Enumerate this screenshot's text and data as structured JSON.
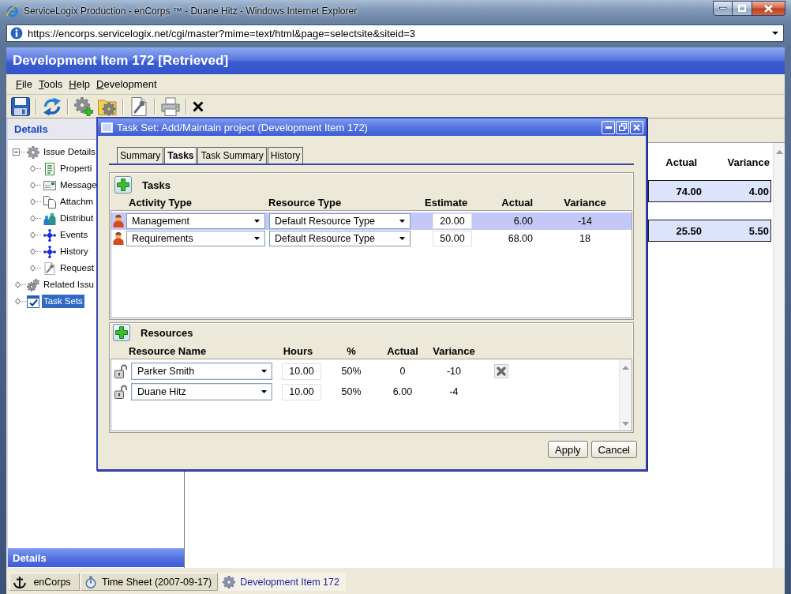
{
  "window": {
    "title": "ServiceLogix Production - enCorps ™ - Duane Hitz - Windows Internet Explorer"
  },
  "address_bar": {
    "url": "https://encorps.servicelogix.net/cgi/master?mime=text/html&page=selectsite&siteid=3"
  },
  "page_header": {
    "title": "Development Item 172 [Retrieved]"
  },
  "menu": [
    {
      "label": "File"
    },
    {
      "label": "Tools"
    },
    {
      "label": "Help"
    },
    {
      "label": "Development"
    }
  ],
  "sidebar": {
    "title": "Details",
    "tree": [
      {
        "label": "Issue Details",
        "expanded": true,
        "selected": false,
        "children": [
          {
            "label": "Properti",
            "selected": false
          },
          {
            "label": "Message",
            "selected": false
          },
          {
            "label": "Attachm",
            "selected": false
          },
          {
            "label": "Distribut",
            "selected": false
          },
          {
            "label": "Events",
            "selected": false
          },
          {
            "label": "History",
            "selected": false
          },
          {
            "label": "Request",
            "selected": false
          }
        ]
      },
      {
        "label": "Related Issu",
        "selected": false
      },
      {
        "label": "Task Sets",
        "selected": true
      }
    ],
    "footer": "Details"
  },
  "main_pane": {
    "columns": [
      "Actual",
      "Variance"
    ],
    "rows": [
      [
        "74.00",
        "4.00"
      ],
      [
        "25.50",
        "5.50"
      ]
    ]
  },
  "dialog": {
    "title": "Task Set: Add/Maintain project (Development Item 172)",
    "tabs": [
      {
        "label": "Summary",
        "selected": false
      },
      {
        "label": "Tasks",
        "selected": true
      },
      {
        "label": "Task Summary",
        "selected": false
      },
      {
        "label": "History",
        "selected": false
      }
    ],
    "tasks": {
      "title": "Tasks",
      "columns": [
        "Activity Type",
        "Resource Type",
        "Estimate",
        "Actual",
        "Variance"
      ],
      "rows": [
        {
          "selected": true,
          "activity_type": "Management",
          "resource_type": "Default Resource Type",
          "estimate": "20.00",
          "actual": "6.00",
          "variance": "-14"
        },
        {
          "selected": false,
          "activity_type": "Requirements",
          "resource_type": "Default Resource Type",
          "estimate": "50.00",
          "actual": "68.00",
          "variance": "18"
        }
      ]
    },
    "resources": {
      "title": "Resources",
      "columns": [
        "Resource Name",
        "Hours",
        "%",
        "Actual",
        "Variance"
      ],
      "rows": [
        {
          "resource_name": "Parker Smith",
          "hours": "10.00",
          "percent": "50%",
          "actual": "0",
          "variance": "-10",
          "removable": true
        },
        {
          "resource_name": "Duane Hitz",
          "hours": "10.00",
          "percent": "50%",
          "actual": "6.00",
          "variance": "-4",
          "removable": false
        }
      ]
    },
    "buttons": [
      "Apply",
      "Cancel"
    ]
  },
  "taskbar": [
    {
      "label": "enCorps",
      "selected": false
    },
    {
      "label": "Time Sheet (2007-09-17)",
      "selected": false
    },
    {
      "label": "Development Item 172",
      "selected": true
    }
  ]
}
